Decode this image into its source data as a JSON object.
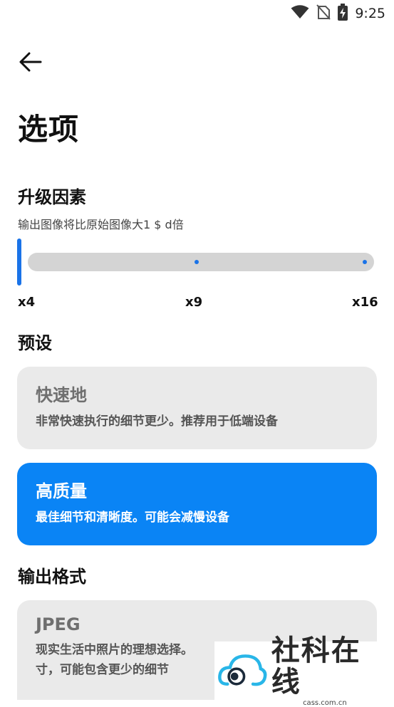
{
  "status_bar": {
    "time": "9:25",
    "icons": [
      "wifi-icon",
      "no-sim-icon",
      "battery-charging-icon"
    ]
  },
  "header": {
    "back_icon": "arrow-left-icon"
  },
  "page": {
    "title": "选项"
  },
  "upscale": {
    "title": "升级因素",
    "subtitle": "输出图像将比原始图像大1 $ d倍",
    "slider": {
      "value": 4,
      "min": 4,
      "max": 16
    },
    "ticks": [
      "x4",
      "x9",
      "x16"
    ]
  },
  "preset": {
    "title": "预设",
    "options": [
      {
        "title": "快速地",
        "desc": "非常快速执行的细节更少。推荐用于低端设备",
        "selected": false
      },
      {
        "title": "高质量",
        "desc": "最佳细节和清晰度。可能会减慢设备",
        "selected": true
      }
    ]
  },
  "output_format": {
    "title": "输出格式",
    "options": [
      {
        "title": "JPEG",
        "desc_line1": "现实生活中照片的理想选择。",
        "desc_line2": "寸，可能包含更少的细节"
      }
    ]
  },
  "watermark": {
    "text": "社科在线",
    "sub": "cass.com.cn"
  },
  "colors": {
    "accent": "#0a84f5",
    "card_grey": "#eaeaea",
    "track": "#d4d4d4"
  }
}
